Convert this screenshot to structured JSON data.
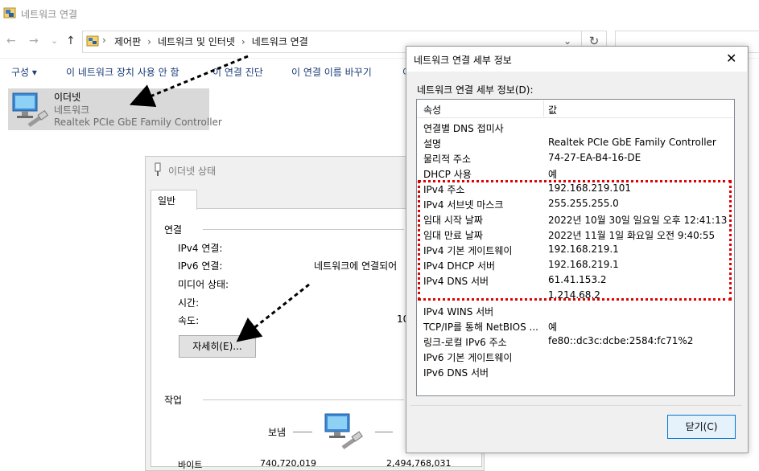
{
  "window": {
    "title": "네트워크 연결"
  },
  "nav": {
    "back": "←",
    "forward": "→",
    "dropdown": "⌄",
    "up": "↑",
    "refresh": "↻",
    "address_dropdown": "⌄"
  },
  "breadcrumb": [
    "제어판",
    "네트워크 및 인터넷",
    "네트워크 연결"
  ],
  "toolbar": {
    "organize": "구성 ▾",
    "disable": "이 네트워크 장치 사용 안 함",
    "diagnose": "이 연결 진단",
    "rename": "이 연결 이름 바꾸기",
    "more": "이"
  },
  "adapter": {
    "name": "이더넷",
    "network": "네트워크",
    "device": "Realtek PCIe GbE Family Controller"
  },
  "status_dialog": {
    "title": "이더넷 상태",
    "tab": "일반",
    "section_connection": "연결",
    "rows": [
      {
        "label": "IPv4 연결:",
        "value": ""
      },
      {
        "label": "IPv6 연결:",
        "value": "네트워크에 연결되어"
      },
      {
        "label": "미디어 상태:",
        "value": ""
      },
      {
        "label": "시간:",
        "value": ""
      },
      {
        "label": "속도:",
        "value": "10"
      }
    ],
    "details_button": "자세히(E)...",
    "section_activity": "작업",
    "sent_label": "보냄",
    "bottom_partial_left": "바이트",
    "bottom_partial_mid": "740,720,019",
    "bottom_partial_right": "2,494,768,031"
  },
  "details_dialog": {
    "title": "네트워크 연결 세부 정보",
    "label": "네트워크 연결 세부 정보(D):",
    "col_property": "속성",
    "col_value": "값",
    "rows": [
      {
        "p": "연결별 DNS 접미사",
        "v": ""
      },
      {
        "p": "설명",
        "v": "Realtek PCIe GbE Family Controller"
      },
      {
        "p": "물리적 주소",
        "v": "74-27-EA-B4-16-DE"
      },
      {
        "p": "DHCP 사용",
        "v": "예"
      },
      {
        "p": "IPv4 주소",
        "v": "192.168.219.101"
      },
      {
        "p": "IPv4 서브넷 마스크",
        "v": "255.255.255.0"
      },
      {
        "p": "임대 시작 날짜",
        "v": "2022년 10월 30일 일요일 오후 12:41:13"
      },
      {
        "p": "임대 만료 날짜",
        "v": "2022년 11월 1일 화요일 오전 9:40:55"
      },
      {
        "p": "IPv4 기본 게이트웨이",
        "v": "192.168.219.1"
      },
      {
        "p": "IPv4 DHCP 서버",
        "v": "192.168.219.1"
      },
      {
        "p": "IPv4 DNS 서버",
        "v": "61.41.153.2"
      },
      {
        "p": "",
        "v": "1.214.68.2"
      },
      {
        "p": "IPv4 WINS 서버",
        "v": ""
      },
      {
        "p": "TCP/IP를 통해 NetBIOS ...",
        "v": "예"
      },
      {
        "p": "링크-로컬 IPv6 주소",
        "v": "fe80::dc3c:dcbe:2584:fc71%2"
      },
      {
        "p": "IPv6 기본 게이트웨이",
        "v": ""
      },
      {
        "p": "IPv6 DNS 서버",
        "v": ""
      }
    ],
    "close_button": "닫기(C)",
    "close_x": "✕"
  },
  "colors": {
    "highlight": "#e00000",
    "accent": "#0078d7",
    "toolbar_text": "#1a3c78"
  }
}
